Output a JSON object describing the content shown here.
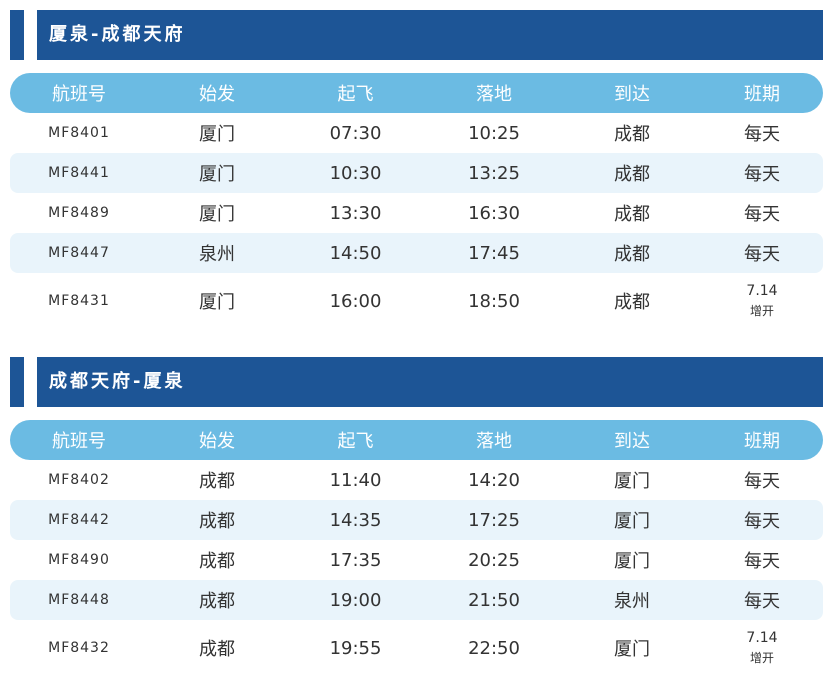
{
  "sections": [
    {
      "title": "厦泉-成都天府",
      "headers": [
        "航班号",
        "始发",
        "起飞",
        "落地",
        "到达",
        "班期"
      ],
      "rows": [
        {
          "flight": "MF8401",
          "origin": "厦门",
          "depart": "07:30",
          "arrive": "10:25",
          "dest": "成都",
          "days": "每天"
        },
        {
          "flight": "MF8441",
          "origin": "厦门",
          "depart": "10:30",
          "arrive": "13:25",
          "dest": "成都",
          "days": "每天"
        },
        {
          "flight": "MF8489",
          "origin": "厦门",
          "depart": "13:30",
          "arrive": "16:30",
          "dest": "成都",
          "days": "每天"
        },
        {
          "flight": "MF8447",
          "origin": "泉州",
          "depart": "14:50",
          "arrive": "17:45",
          "dest": "成都",
          "days": "每天"
        },
        {
          "flight": "MF8431",
          "origin": "厦门",
          "depart": "16:00",
          "arrive": "18:50",
          "dest": "成都",
          "days_line1": "7.14",
          "days_line2": "增开"
        }
      ]
    },
    {
      "title": "成都天府-厦泉",
      "headers": [
        "航班号",
        "始发",
        "起飞",
        "落地",
        "到达",
        "班期"
      ],
      "rows": [
        {
          "flight": "MF8402",
          "origin": "成都",
          "depart": "11:40",
          "arrive": "14:20",
          "dest": "厦门",
          "days": "每天"
        },
        {
          "flight": "MF8442",
          "origin": "成都",
          "depart": "14:35",
          "arrive": "17:25",
          "dest": "厦门",
          "days": "每天"
        },
        {
          "flight": "MF8490",
          "origin": "成都",
          "depart": "17:35",
          "arrive": "20:25",
          "dest": "厦门",
          "days": "每天"
        },
        {
          "flight": "MF8448",
          "origin": "成都",
          "depart": "19:00",
          "arrive": "21:50",
          "dest": "泉州",
          "days": "每天"
        },
        {
          "flight": "MF8432",
          "origin": "成都",
          "depart": "19:55",
          "arrive": "22:50",
          "dest": "厦门",
          "days_line1": "7.14",
          "days_line2": "增开"
        }
      ]
    }
  ],
  "colors": {
    "title_bg": "#1d5596",
    "header_bg": "#6bbbe3",
    "alt_row_bg": "#e9f4fb",
    "text": "#333333"
  }
}
